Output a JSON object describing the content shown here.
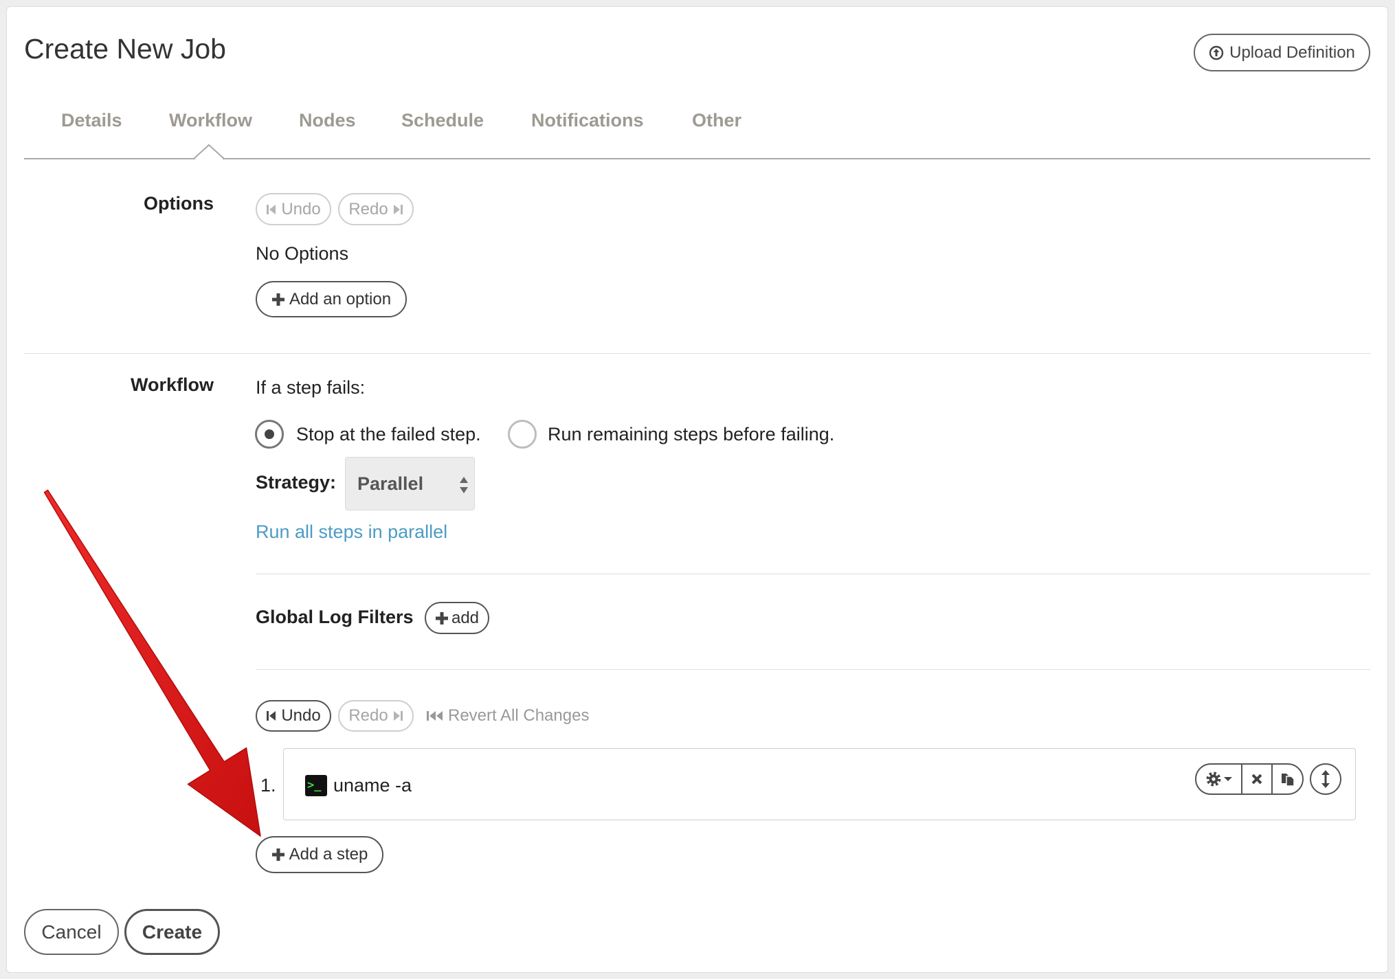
{
  "page": {
    "title": "Create New Job"
  },
  "header": {
    "upload_label": "Upload Definition",
    "upload_icon": "upload-circle-icon"
  },
  "tabs": [
    {
      "label": "Details",
      "active": false
    },
    {
      "label": "Workflow",
      "active": true
    },
    {
      "label": "Nodes",
      "active": false
    },
    {
      "label": "Schedule",
      "active": false
    },
    {
      "label": "Notifications",
      "active": false
    },
    {
      "label": "Other",
      "active": false
    }
  ],
  "options": {
    "label": "Options",
    "undo_label": "Undo",
    "redo_label": "Redo",
    "empty_text": "No Options",
    "add_label": "Add an option"
  },
  "workflow": {
    "label": "Workflow",
    "fail_prompt": "If a step fails:",
    "fail_options": [
      {
        "label": "Stop at the failed step.",
        "selected": true
      },
      {
        "label": "Run remaining steps before failing.",
        "selected": false
      }
    ],
    "strategy_label": "Strategy:",
    "strategy_value": "Parallel",
    "strategy_description": "Run all steps in parallel",
    "log_filters_label": "Global Log Filters",
    "log_filters_add_label": "add",
    "undo_label": "Undo",
    "redo_label": "Redo",
    "revert_label": "Revert All Changes",
    "steps": [
      {
        "number": "1.",
        "command": "uname -a",
        "icon": "terminal-icon"
      }
    ],
    "add_step_label": "Add a step"
  },
  "footer": {
    "cancel_label": "Cancel",
    "create_label": "Create"
  },
  "colors": {
    "tab_text": "#9e9a93",
    "link": "#4c9bc4",
    "annotation_arrow": "#e01e1e",
    "terminal_prompt": "#3ddc3d"
  }
}
